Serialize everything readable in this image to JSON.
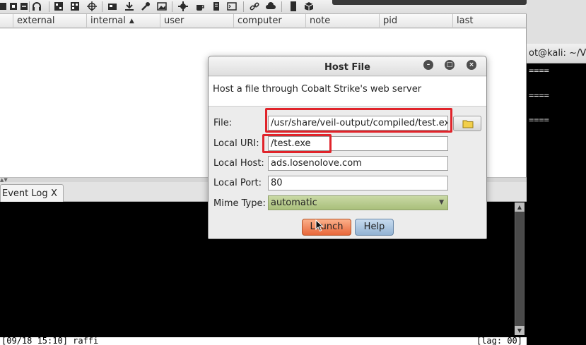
{
  "toolbar": {
    "icons": [
      "disconnect-icon",
      "new-connection-icon",
      "preferences-icon",
      "headphones-icon",
      "pivot-graph-icon",
      "session-table-icon",
      "target-icon",
      "credentials-icon",
      "downloads-icon",
      "keystrokes-icon",
      "screenshots-icon",
      "settings-icon",
      "coffee-icon",
      "script-icon",
      "console-icon",
      "link-icon",
      "cloud-icon",
      "log-icon",
      "package-icon"
    ]
  },
  "table": {
    "columns": [
      {
        "label": "external"
      },
      {
        "label": "internal",
        "sort": "▲"
      },
      {
        "label": "user"
      },
      {
        "label": "computer"
      },
      {
        "label": "note"
      },
      {
        "label": "pid"
      },
      {
        "label": "last"
      }
    ]
  },
  "tabs": [
    {
      "label": "Event Log",
      "close": "X"
    }
  ],
  "console": {
    "status_left": "[09/18 15:10] raffi",
    "status_right": "[lag: 00]"
  },
  "terminal": {
    "title": "ot@kali: ~/Ve",
    "lines": [
      "====",
      "====",
      "===="
    ]
  },
  "dialog": {
    "title": "Host File",
    "description": "Host a file through Cobalt Strike's web server",
    "fields": {
      "file": {
        "label": "File:",
        "value": "/usr/share/veil-output/compiled/test.exe"
      },
      "local_uri": {
        "label": "Local URI:",
        "value": "/test.exe"
      },
      "local_host": {
        "label": "Local Host:",
        "value": "ads.losenolove.com"
      },
      "local_port": {
        "label": "Local Port:",
        "value": "80"
      },
      "mime_type": {
        "label": "Mime Type:",
        "value": "automatic"
      }
    },
    "buttons": {
      "launch": "Launch",
      "help": "Help"
    },
    "window_buttons": {
      "minimize": "–",
      "maximize": "□",
      "close": "×"
    }
  },
  "colors": {
    "highlight": "#e0232a",
    "launch_button": "#e8673a",
    "help_button": "#93b3d3",
    "mime_select": "#b6c98a"
  }
}
